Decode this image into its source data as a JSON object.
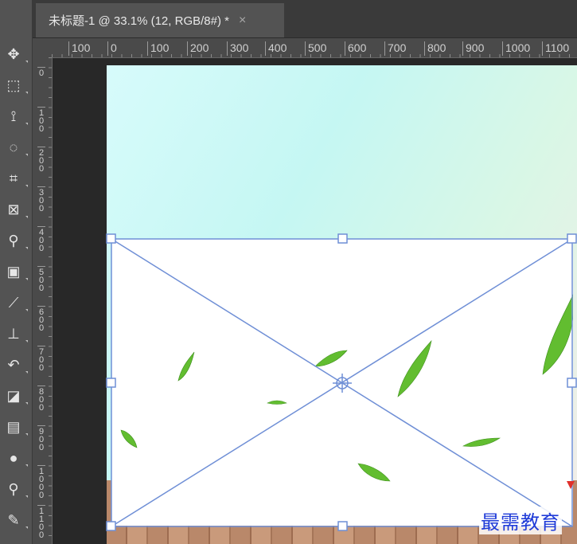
{
  "document_tab": {
    "title": "未标题-1 @ 33.1% (12, RGB/8#) *",
    "close_glyph": "×"
  },
  "tools": [
    {
      "name": "move-tool",
      "icon": "move-icon",
      "glyph": "✥"
    },
    {
      "name": "marquee-tool",
      "icon": "marquee-icon",
      "glyph": "⬚"
    },
    {
      "name": "lasso-tool",
      "icon": "lasso-icon",
      "glyph": "⟟"
    },
    {
      "name": "quick-selection-tool",
      "icon": "quick-selection-icon",
      "glyph": "◌"
    },
    {
      "name": "crop-tool",
      "icon": "crop-icon",
      "glyph": "⌗"
    },
    {
      "name": "frame-tool",
      "icon": "frame-icon",
      "glyph": "⊠"
    },
    {
      "name": "eyedropper-tool",
      "icon": "eyedropper-icon",
      "glyph": "⚲"
    },
    {
      "name": "healing-brush-tool",
      "icon": "bandage-icon",
      "glyph": "▣"
    },
    {
      "name": "brush-tool",
      "icon": "brush-icon",
      "glyph": "⟋"
    },
    {
      "name": "clone-stamp-tool",
      "icon": "stamp-icon",
      "glyph": "⊥"
    },
    {
      "name": "history-brush-tool",
      "icon": "history-brush-icon",
      "glyph": "↶"
    },
    {
      "name": "eraser-tool",
      "icon": "eraser-icon",
      "glyph": "◪"
    },
    {
      "name": "gradient-tool",
      "icon": "gradient-icon",
      "glyph": "▤"
    },
    {
      "name": "blur-tool",
      "icon": "drop-icon",
      "glyph": "●"
    },
    {
      "name": "dodge-tool",
      "icon": "dodge-icon",
      "glyph": "⚲"
    },
    {
      "name": "pen-tool",
      "icon": "pen-icon",
      "glyph": "✎"
    }
  ],
  "ruler_h": [
    "100",
    "0",
    "100",
    "200",
    "300",
    "400",
    "500",
    "600",
    "700",
    "800",
    "900",
    "1000",
    "1100"
  ],
  "ruler_v": [
    "0",
    "100",
    "200",
    "300",
    "400",
    "500",
    "600",
    "700",
    "800",
    "900",
    "1000",
    "1100"
  ],
  "watermark": "最需教育",
  "colors": {
    "transform_frame": "#6f8fd6",
    "leaf_green": "#5db82e"
  }
}
